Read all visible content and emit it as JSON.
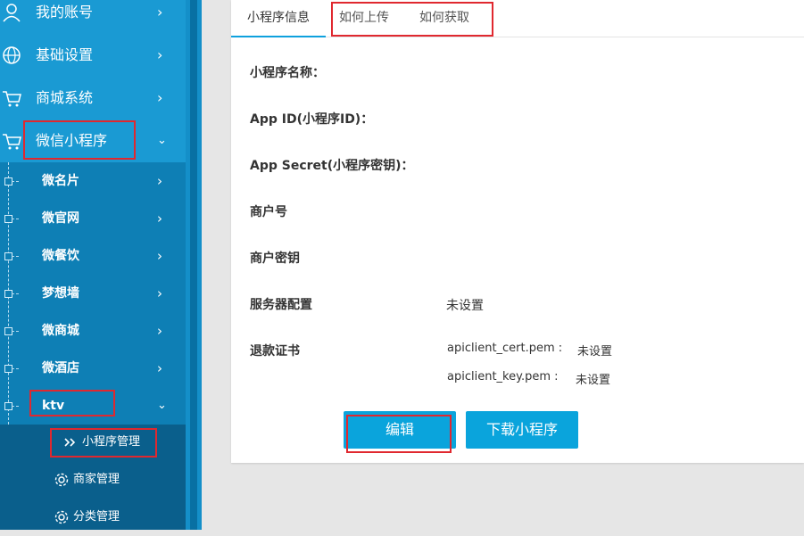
{
  "sidebar": {
    "items": [
      {
        "label": "我的账号",
        "icon": "user-icon"
      },
      {
        "label": "基础设置",
        "icon": "globe-icon"
      },
      {
        "label": "商城系统",
        "icon": "cart-icon"
      },
      {
        "label": "微信小程序",
        "icon": "cart-icon"
      }
    ],
    "sub_items": [
      "微名片",
      "微官网",
      "微餐饮",
      "梦想墙",
      "微商城",
      "微酒店",
      "ktv"
    ],
    "deep_items": [
      {
        "label": "小程序管理",
        "icon": "double-chevron-icon"
      },
      {
        "label": "商家管理",
        "icon": "gear-icon"
      },
      {
        "label": "分类管理",
        "icon": "gear-icon"
      }
    ]
  },
  "tabs": [
    "小程序信息",
    "如何上传",
    "如何获取"
  ],
  "fields": {
    "name_label": "小程序名称：",
    "appid_label": "App ID(小程序ID)：",
    "secret_label": "App Secret(小程序密钥)：",
    "merchant_no_label": "商户号",
    "merchant_key_label": "商户密钥",
    "server_label": "服务器配置",
    "server_value": "未设置",
    "refund_label": "退款证书",
    "cert_name": "apiclient_cert.pem :",
    "cert_value": "未设置",
    "key_name": "apiclient_key.pem :",
    "key_value": "未设置"
  },
  "buttons": {
    "edit": "编辑",
    "download": "下载小程序"
  },
  "colors": {
    "sidebar": "#0f8fc7",
    "accent": "#0aa4dc",
    "highlight": "#e0282f"
  }
}
